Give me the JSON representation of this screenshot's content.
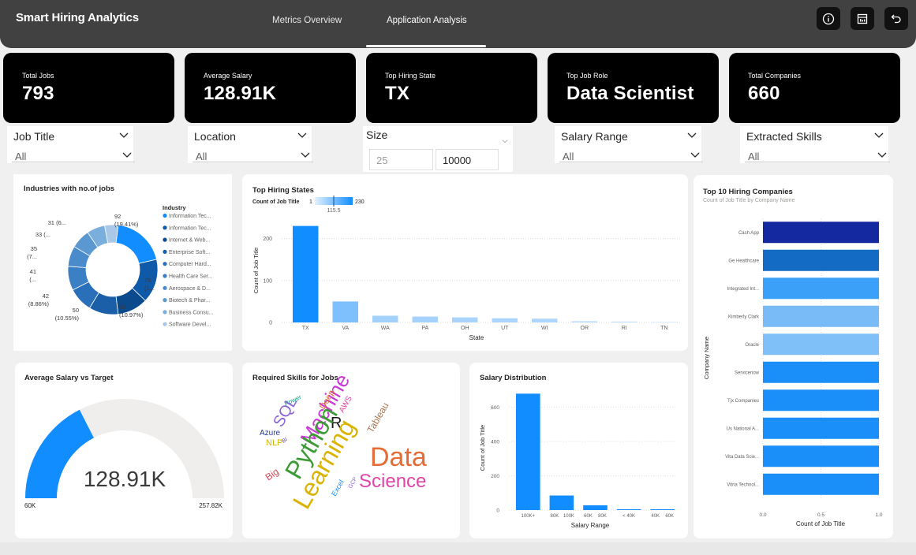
{
  "header": {
    "title": "Smart Hiring Analytics",
    "tabs": [
      {
        "label": "Metrics Overview",
        "active": false
      },
      {
        "label": "Application Analysis",
        "active": true
      }
    ],
    "buttons": [
      "info-icon",
      "report-icon",
      "back-icon"
    ]
  },
  "kpis": [
    {
      "label": "Total Jobs",
      "value": "793"
    },
    {
      "label": "Average Salary",
      "value": "128.91K"
    },
    {
      "label": "Top Hiring State",
      "value": "TX"
    },
    {
      "label": "Top Job Role",
      "value": "Data Scientist"
    },
    {
      "label": "Total Companies",
      "value": "660"
    }
  ],
  "slicers": {
    "job_title": {
      "title": "Job Title",
      "value": "All"
    },
    "location": {
      "title": "Location",
      "value": "All"
    },
    "size": {
      "title": "Size",
      "min": "25",
      "max": "10000"
    },
    "salary_range": {
      "title": "Salary Range",
      "value": "All"
    },
    "skills": {
      "title": "Extracted Skills",
      "value": "All"
    }
  },
  "industries": {
    "title": "Industries with no.of jobs",
    "legend_title": "Industry",
    "legend": [
      {
        "label": "Information Tec...",
        "color": "#118dff"
      },
      {
        "label": "Information Tec...",
        "color": "#0f5aa8"
      },
      {
        "label": "Internet & Web...",
        "color": "#0b4a8c"
      },
      {
        "label": "Enterprise Soft...",
        "color": "#1a5fa8"
      },
      {
        "label": "Computer Hard...",
        "color": "#2a6fba"
      },
      {
        "label": "Health Care Ser...",
        "color": "#3b7fc4"
      },
      {
        "label": "Aerospace & D...",
        "color": "#4a8bcc"
      },
      {
        "label": "Biotech & Phar...",
        "color": "#5b98d2"
      },
      {
        "label": "Business Consu...",
        "color": "#7aaedc"
      },
      {
        "label": "Software Devel...",
        "color": "#a9c8e8"
      }
    ],
    "labels": [
      {
        "text": "92",
        "sub": "(19.41%)"
      },
      {
        "text": "75",
        "sub": "(1..."
      },
      {
        "text": "52",
        "sub": "(10.97%)"
      },
      {
        "text": "50",
        "sub": "(10.55%)"
      },
      {
        "text": "42",
        "sub": "(8.86%)"
      },
      {
        "text": "41",
        "sub": "(..."
      },
      {
        "text": "35",
        "sub": "(7..."
      },
      {
        "text": "33 (...",
        "sub": ""
      },
      {
        "text": "31 (6...",
        "sub": ""
      }
    ]
  },
  "avg_salary_gauge": {
    "title": "Average Salary vs Target",
    "value": "128.91K",
    "min": "60K",
    "max": "257.82K",
    "fill_fraction": 0.35,
    "color": "#118dff"
  },
  "skills_cloud": {
    "title": "Required Skills for Jobs",
    "words": [
      {
        "text": "Power",
        "color": "#14a085"
      },
      {
        "text": "SQL",
        "color": "#8a64d6"
      },
      {
        "text": "Machine",
        "color": "#c93bd6"
      },
      {
        "text": "Deep",
        "color": "#e66c37"
      },
      {
        "text": "AWS",
        "color": "#e044a7"
      },
      {
        "text": "Tableau",
        "color": "#a9744f"
      },
      {
        "text": "Azure",
        "color": "#243d96"
      },
      {
        "text": "R",
        "color": "#1a1a1a"
      },
      {
        "text": "NLP",
        "color": "#d9b300"
      },
      {
        "text": "Python",
        "color": "#3d9b35"
      },
      {
        "text": "Data",
        "color": "#e66c37"
      },
      {
        "text": "Big",
        "color": "#d64550"
      },
      {
        "text": "Learning",
        "color": "#d9b300"
      },
      {
        "text": "Science",
        "color": "#e044a7"
      },
      {
        "text": "Excel",
        "color": "#118dff"
      },
      {
        "text": "GCP",
        "color": "#8a64d6"
      },
      {
        "text": "BI",
        "color": "#744ec2"
      }
    ]
  },
  "chart_data": [
    {
      "id": "top_hiring_states",
      "type": "bar",
      "title": "Top Hiring States",
      "xlabel": "State",
      "ylabel": "Count of Job Title",
      "legend_label": "Count of Job Title",
      "legend_min": "1",
      "legend_mid": "115.5",
      "legend_max": "230",
      "categories": [
        "TX",
        "VA",
        "WA",
        "PA",
        "OH",
        "UT",
        "WI",
        "OR",
        "RI",
        "TN"
      ],
      "values": [
        230,
        50,
        16,
        14,
        12,
        10,
        9,
        3,
        2,
        1
      ],
      "ylim": [
        0,
        250
      ],
      "yticks": [
        "0",
        "100",
        "200"
      ],
      "colors": {
        "high": "#118dff",
        "low": "#c7e2fb"
      }
    },
    {
      "id": "salary_distribution",
      "type": "bar",
      "title": "Salary Distribution",
      "xlabel": "Salary Range",
      "ylabel": "Count of Job Title",
      "categories": [
        "100K+",
        "80K 100K",
        "60K 80K",
        "< 40K",
        "40K 60K"
      ],
      "category_lines": [
        [
          "100K+"
        ],
        [
          "80K",
          "100K"
        ],
        [
          "60K",
          "80K"
        ],
        [
          "< 40K"
        ],
        [
          "40K",
          "60K"
        ]
      ],
      "values": [
        680,
        85,
        28,
        5,
        5
      ],
      "ylim": [
        0,
        700
      ],
      "yticks": [
        "0",
        "200",
        "400",
        "600"
      ],
      "color": "#118dff"
    },
    {
      "id": "top_companies",
      "type": "bar",
      "orientation": "horizontal",
      "title": "Top 10 Hiring Companies",
      "subtitle": "Count of Job Title by Company Name",
      "xlabel": "Count of Job Title",
      "ylabel": "Company Name",
      "categories": [
        "Cash App",
        "Ge Healthcare",
        "Integrated Int...",
        "Kimberly Clark",
        "Oracle",
        "Servicenow",
        "Tjx Companies",
        "Us National A...",
        "Vita Data Scie...",
        "Vitria Technol..."
      ],
      "values": [
        1,
        1,
        1,
        1,
        1,
        1,
        1,
        1,
        1,
        1
      ],
      "colors": [
        "#1428a0",
        "#136bc4",
        "#3aa0f8",
        "#79bbf7",
        "#80c0f8",
        "#1b8ff9",
        "#1b8ff9",
        "#1b8ff9",
        "#1b8ff9",
        "#1b8ff9"
      ],
      "xlim": [
        0,
        1
      ],
      "xticks": [
        "0.0",
        "0.5",
        "1.0"
      ]
    }
  ]
}
